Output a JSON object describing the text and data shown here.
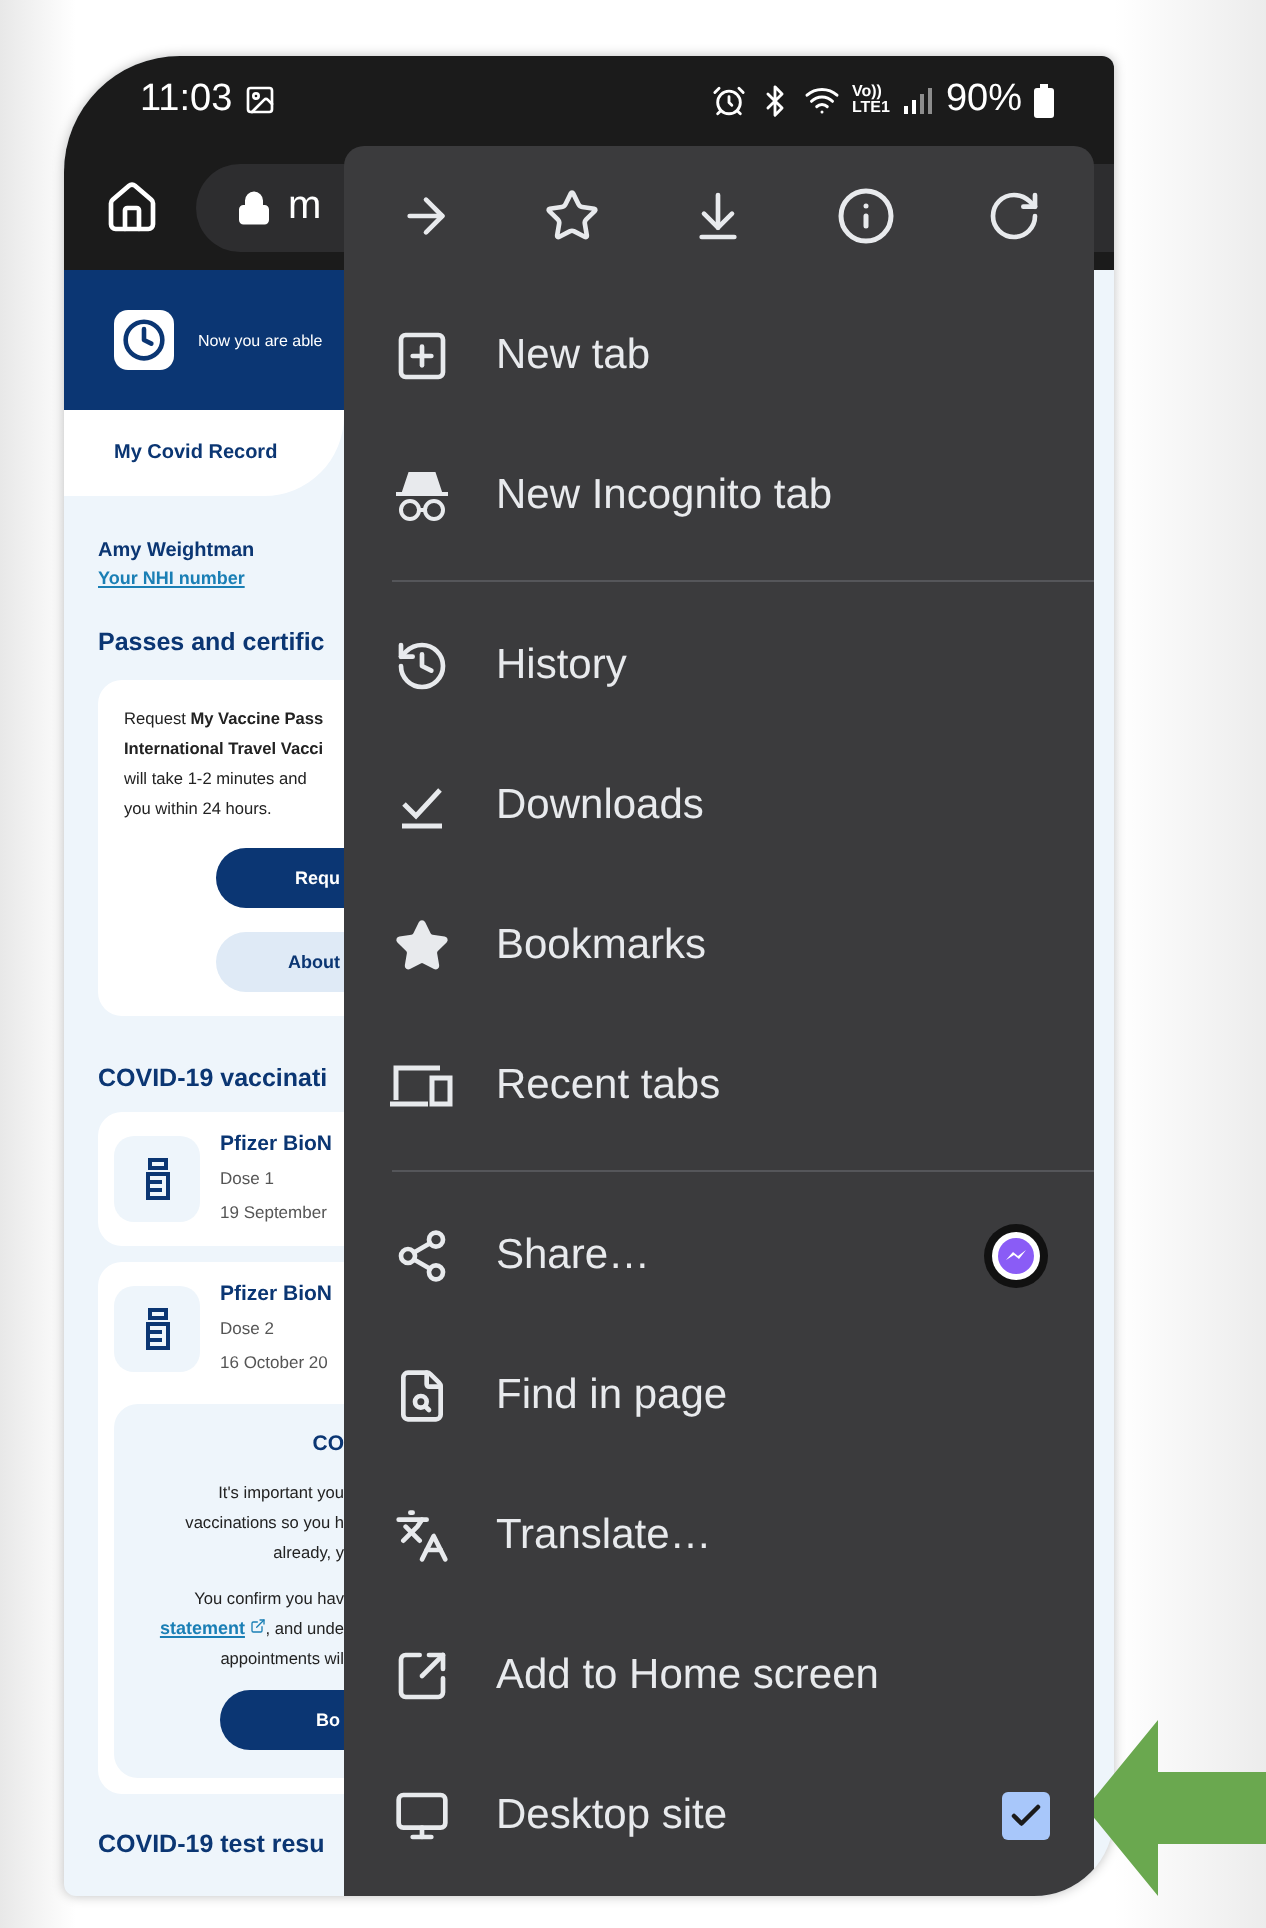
{
  "status_bar": {
    "time": "11:03",
    "volte_label": "Vo))",
    "network_label": "LTE1",
    "battery": "90%"
  },
  "toolbar": {
    "url": "m"
  },
  "site": {
    "banner": "Now you are able",
    "tab": "My Covid Record",
    "user_name": "Amy Weightman",
    "nhi_link": "Your NHI number",
    "passes_heading": "Passes and certific",
    "passes_text": "Request **My Vaccine Pass**\n**International Travel Vacci**\nwill take 1-2 minutes and\nyou within 24 hours.",
    "primary_button": "Requ",
    "secondary_button": "About",
    "vaccinations_heading": "COVID-19 vaccinati",
    "vaccinations": [
      {
        "name": "Pfizer BioN",
        "dose": "Dose 1",
        "date": "19 September"
      },
      {
        "name": "Pfizer BioN",
        "dose": "Dose 2",
        "date": "16 October 20"
      }
    ],
    "booking": {
      "heading": "CO",
      "text_1": "It's important you\nvaccinations so you h\nalready, y",
      "text_2_before": "You confirm you hav",
      "link": "statement",
      "text_2_after": ", and unde\nappointments wil",
      "button": "Bo"
    },
    "tests_heading": "COVID-19 test resu"
  },
  "menu": {
    "groups": [
      [
        {
          "label": "New tab",
          "kind": "plain"
        },
        {
          "label": "New Incognito tab",
          "kind": "plain"
        }
      ],
      [
        {
          "label": "History",
          "kind": "plain"
        },
        {
          "label": "Downloads",
          "kind": "plain"
        },
        {
          "label": "Bookmarks",
          "kind": "plain"
        },
        {
          "label": "Recent tabs",
          "kind": "plain"
        }
      ],
      [
        {
          "label": "Share…",
          "kind": "share"
        },
        {
          "label": "Find in page",
          "kind": "plain"
        },
        {
          "label": "Translate…",
          "kind": "plain"
        },
        {
          "label": "Add to Home screen",
          "kind": "plain"
        },
        {
          "label": "Desktop site",
          "kind": "checkbox",
          "checked": true
        }
      ]
    ]
  }
}
